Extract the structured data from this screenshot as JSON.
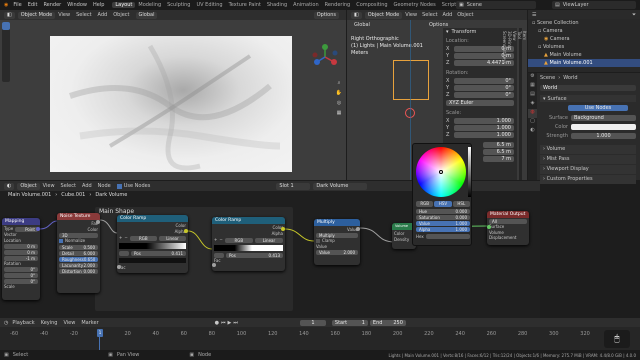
{
  "topbar": {
    "menus": [
      "File",
      "Edit",
      "Render",
      "Window",
      "Help"
    ],
    "workspaces": [
      "Layout",
      "Modeling",
      "Sculpting",
      "UV Editing",
      "Texture Paint",
      "Shading",
      "Animation",
      "Rendering",
      "Compositing",
      "Geometry Nodes",
      "Scripting"
    ],
    "active_workspace": "Layout",
    "scene": "Scene",
    "view_layer": "ViewLayer"
  },
  "viewport_left": {
    "mode": "Object Mode",
    "menus": [
      "View",
      "Select",
      "Add",
      "Object"
    ],
    "transform": "Global",
    "options": "Options"
  },
  "viewport_right": {
    "mode": "Object Mode",
    "menus": [
      "View",
      "Select",
      "Add",
      "Object"
    ],
    "transform": "Global",
    "options": "Options",
    "view_name": "Right Orthographic",
    "collection": "(1) Lights | Main Volume.001",
    "units": "Meters"
  },
  "npanel": {
    "title": "Transform",
    "tabs": [
      "Item",
      "Tool",
      "View",
      "3D-Print",
      "Screencast Keys"
    ],
    "location_label": "Location:",
    "location": [
      {
        "axis": "X",
        "value": "0 m"
      },
      {
        "axis": "Y",
        "value": "0 m"
      },
      {
        "axis": "Z",
        "value": "4.4471 m"
      }
    ],
    "rotation_label": "Rotation:",
    "rotation": [
      {
        "axis": "X",
        "value": "0°"
      },
      {
        "axis": "Y",
        "value": "0°"
      },
      {
        "axis": "Z",
        "value": "0°"
      }
    ],
    "rotation_mode": "XYZ Euler",
    "scale_label": "Scale:",
    "scale": [
      {
        "axis": "X",
        "value": "1.000"
      },
      {
        "axis": "Y",
        "value": "1.000"
      },
      {
        "axis": "Z",
        "value": "1.000"
      }
    ],
    "dimensions": [
      "6.5 m",
      "6.5 m",
      "7 m"
    ]
  },
  "color_picker": {
    "modes": [
      "RGB",
      "HSV",
      "HSL"
    ],
    "active_mode": "HSV",
    "rows": [
      {
        "label": "Hue",
        "value": "0.000"
      },
      {
        "label": "Saturation",
        "value": "0.000"
      },
      {
        "label": "Value",
        "value": "1.000"
      },
      {
        "label": "Alpha",
        "value": "1.000"
      }
    ],
    "hex": "Hex"
  },
  "outliner": {
    "items": [
      {
        "label": "Scene Collection",
        "indent": 0
      },
      {
        "label": "Camera",
        "indent": 1
      },
      {
        "label": "Camera",
        "indent": 2
      },
      {
        "label": "Volumes",
        "indent": 1
      },
      {
        "label": "Main Volume",
        "indent": 2
      },
      {
        "label": "Main Volume.001",
        "indent": 2,
        "selected": true
      }
    ]
  },
  "properties": {
    "breadcrumb": [
      "Scene",
      "World"
    ],
    "world_name": "World",
    "surface_section": "Surface",
    "use_nodes_label": "Use Nodes",
    "surface_label": "Surface",
    "surface_value": "Background",
    "color_label": "Color",
    "strength_label": "Strength",
    "strength_value": "1.000",
    "sections": [
      "Volume",
      "Mist Pass",
      "Viewport Display",
      "Custom Properties"
    ]
  },
  "node_editor": {
    "header": {
      "mode": "Object",
      "menus": [
        "View",
        "Select",
        "Add",
        "Node"
      ],
      "use_nodes": "Use Nodes",
      "slot": "Slot 1",
      "material": "Dark Volume"
    },
    "breadcrumb": [
      "Main Volume.001",
      "Cube.001",
      "Dark Volume"
    ],
    "frame_label": "Main Shape",
    "nodes": {
      "mapping": {
        "title": "Mapping",
        "fields": [
          "Type",
          "Point",
          "Vector",
          "Location",
          "X",
          "Y",
          "Z",
          "Rotation",
          "X",
          "Y",
          "Z",
          "Scale"
        ],
        "values": [
          "0 m",
          "0 m",
          "-1 m",
          "0°",
          "0°",
          "0°"
        ],
        "type_value": "Point"
      },
      "noise": {
        "title": "Noise Texture",
        "outputs": [
          "Fac",
          "Color"
        ],
        "dim": "3D",
        "normalize": "Normalize",
        "fields": [
          {
            "label": "Scale",
            "value": "0.500"
          },
          {
            "label": "Detail",
            "value": "6.000"
          },
          {
            "label": "Roughness",
            "value": "0.650"
          },
          {
            "label": "Lacunarity",
            "value": "2.000"
          },
          {
            "label": "Distortion",
            "value": "0.000"
          }
        ]
      },
      "ramp1": {
        "title": "Color Ramp",
        "outputs": [
          "Color",
          "Alpha"
        ],
        "mode": "RGB",
        "interp": "Linear",
        "pos_label": "Pos",
        "pos_value": "0.411",
        "input": "Fac"
      },
      "ramp2": {
        "title": "Color Ramp",
        "outputs": [
          "Color",
          "Alpha"
        ],
        "mode": "RGB",
        "interp": "Linear",
        "pos_label": "Pos",
        "pos_value": "0.413",
        "input": "Fac"
      },
      "multiply": {
        "title": "Multiply",
        "output": "Value",
        "op": "Multiply",
        "clamp": "Clamp",
        "value_label": "Value",
        "value": "2.000"
      },
      "volume": {
        "title": "Volume",
        "fields": [
          "Color",
          "Density"
        ]
      },
      "material_output": {
        "title": "Material Output",
        "target": "All",
        "inputs": [
          "Surface",
          "Volume",
          "Displacement"
        ]
      }
    }
  },
  "timeline": {
    "menus": [
      "Playback",
      "Keying",
      "View",
      "Marker"
    ],
    "current_frame": "1",
    "start_label": "Start",
    "start": "1",
    "end_label": "End",
    "end": "250",
    "ticks": [
      "-60",
      "-40",
      "-20",
      "0",
      "20",
      "40",
      "60",
      "80",
      "100",
      "120",
      "140",
      "160",
      "180",
      "200",
      "220",
      "240",
      "260",
      "280",
      "300",
      "320"
    ],
    "playhead": "1"
  },
  "statusbar": {
    "left": [
      "Select",
      "Pan View",
      "Node"
    ],
    "right": "Lights | Main Volume.001 | Verts:8/16 | Faces:6/12 | Tris:12/24 | Objects:1/6 | Memory: 275.7 MiB | VRAM: 4.4/8.0 GiB | 4.0.0"
  },
  "colors": {
    "accent": "#4772b3",
    "node_green": "#2b6a4b",
    "node_blue_texture": "#8a3a3a",
    "node_color": "#1f5f7a",
    "node_converter": "#2c5f9e",
    "node_output": "#7a2b2b",
    "node_shader": "#2a7a4a",
    "orange": "#e8a23c"
  }
}
